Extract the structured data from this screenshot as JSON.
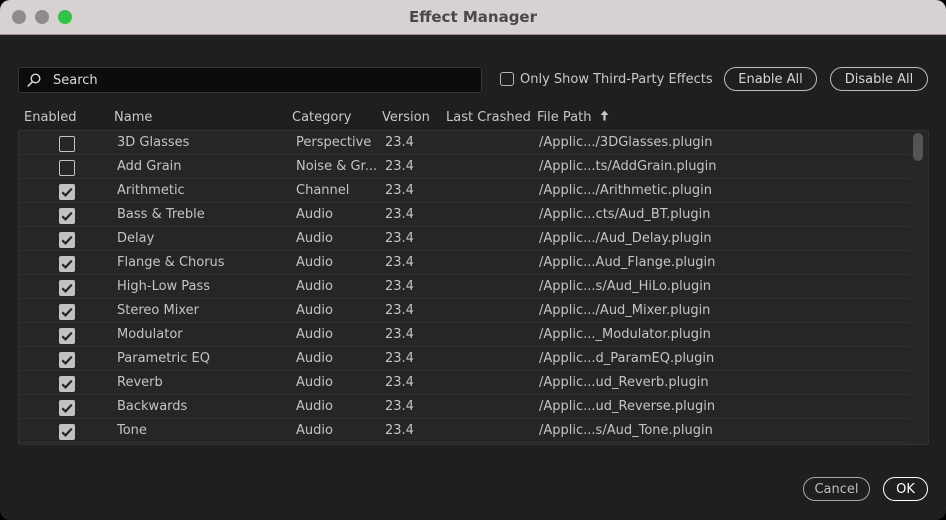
{
  "window": {
    "title": "Effect Manager"
  },
  "search": {
    "placeholder": "Search",
    "value": ""
  },
  "filters": {
    "third_party_label": "Only Show Third-Party Effects",
    "third_party_checked": false
  },
  "buttons": {
    "enable_all": "Enable All",
    "disable_all": "Disable All",
    "cancel": "Cancel",
    "ok": "OK"
  },
  "table": {
    "columns": {
      "enabled": "Enabled",
      "name": "Name",
      "category": "Category",
      "version": "Version",
      "last_crashed": "Last Crashed",
      "file_path": "File Path"
    },
    "sort": {
      "column": "File Path",
      "direction": "ascending"
    },
    "rows": [
      {
        "enabled": false,
        "name": "3D Glasses",
        "category": "Perspective",
        "version": "23.4",
        "last_crashed": "",
        "file_path": "/Applic.../3DGlasses.plugin"
      },
      {
        "enabled": false,
        "name": "Add Grain",
        "category": "Noise & Gr...",
        "version": "23.4",
        "last_crashed": "",
        "file_path": "/Applic...ts/AddGrain.plugin"
      },
      {
        "enabled": true,
        "name": "Arithmetic",
        "category": "Channel",
        "version": "23.4",
        "last_crashed": "",
        "file_path": "/Applic.../Arithmetic.plugin"
      },
      {
        "enabled": true,
        "name": "Bass & Treble",
        "category": "Audio",
        "version": "23.4",
        "last_crashed": "",
        "file_path": "/Applic...cts/Aud_BT.plugin"
      },
      {
        "enabled": true,
        "name": "Delay",
        "category": "Audio",
        "version": "23.4",
        "last_crashed": "",
        "file_path": "/Applic.../Aud_Delay.plugin"
      },
      {
        "enabled": true,
        "name": "Flange & Chorus",
        "category": "Audio",
        "version": "23.4",
        "last_crashed": "",
        "file_path": "/Applic...Aud_Flange.plugin"
      },
      {
        "enabled": true,
        "name": "High-Low Pass",
        "category": "Audio",
        "version": "23.4",
        "last_crashed": "",
        "file_path": "/Applic...s/Aud_HiLo.plugin"
      },
      {
        "enabled": true,
        "name": "Stereo Mixer",
        "category": "Audio",
        "version": "23.4",
        "last_crashed": "",
        "file_path": "/Applic.../Aud_Mixer.plugin"
      },
      {
        "enabled": true,
        "name": "Modulator",
        "category": "Audio",
        "version": "23.4",
        "last_crashed": "",
        "file_path": "/Applic..._Modulator.plugin"
      },
      {
        "enabled": true,
        "name": "Parametric EQ",
        "category": "Audio",
        "version": "23.4",
        "last_crashed": "",
        "file_path": "/Applic...d_ParamEQ.plugin"
      },
      {
        "enabled": true,
        "name": "Reverb",
        "category": "Audio",
        "version": "23.4",
        "last_crashed": "",
        "file_path": "/Applic...ud_Reverb.plugin"
      },
      {
        "enabled": true,
        "name": "Backwards",
        "category": "Audio",
        "version": "23.4",
        "last_crashed": "",
        "file_path": "/Applic...ud_Reverse.plugin"
      },
      {
        "enabled": true,
        "name": "Tone",
        "category": "Audio",
        "version": "23.4",
        "last_crashed": "",
        "file_path": "/Applic...s/Aud_Tone.plugin"
      }
    ]
  },
  "icons": {
    "search": "search-icon",
    "sort": "arrow-up-icon",
    "checkbox_checked": "checkmark-icon"
  },
  "colors": {
    "background": "#1f1f1f",
    "table_background": "#262626",
    "titlebar": "#d7d1d1",
    "zoom_button": "#2fc446"
  }
}
